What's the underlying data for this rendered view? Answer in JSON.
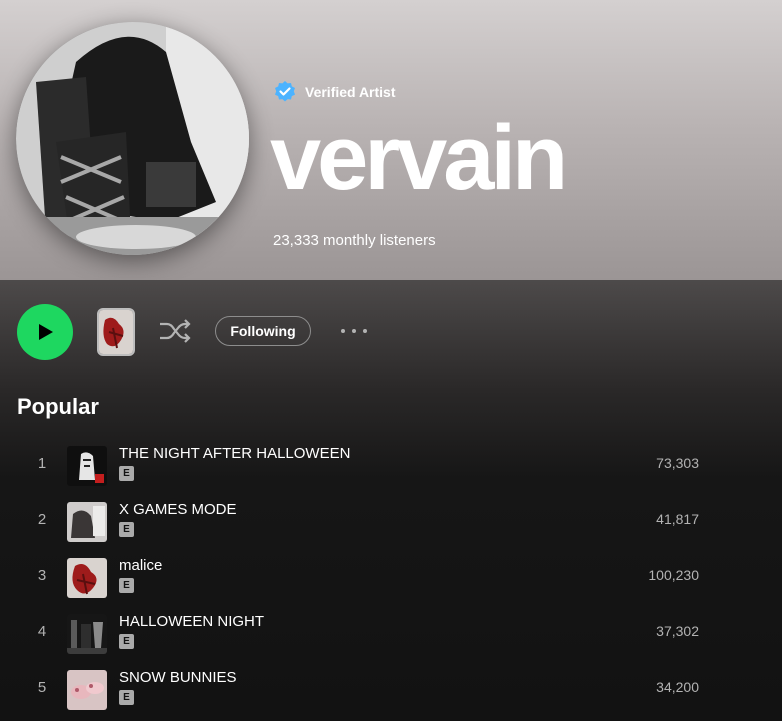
{
  "artist": {
    "verified_label": "Verified Artist",
    "name": "vervain",
    "monthly_listeners": "23,333 monthly listeners"
  },
  "controls": {
    "play_icon": "play-icon",
    "shuffle_icon": "shuffle-icon",
    "following_label": "Following",
    "more_icon": "more-options-icon"
  },
  "popular": {
    "title": "Popular",
    "explicit_badge": "E",
    "tracks": [
      {
        "index": "1",
        "title": "THE NIGHT AFTER HALLOWEEN",
        "plays": "73,303"
      },
      {
        "index": "2",
        "title": "X GAMES MODE",
        "plays": "41,817"
      },
      {
        "index": "3",
        "title": "malice",
        "plays": "100,230"
      },
      {
        "index": "4",
        "title": "HALLOWEEN NIGHT",
        "plays": "37,302"
      },
      {
        "index": "5",
        "title": "SNOW BUNNIES",
        "plays": "34,200"
      }
    ]
  },
  "colors": {
    "accent": "#1ed760",
    "verified_blue": "#4cb3ff",
    "background": "#121212",
    "text_secondary": "#b3b3b3"
  }
}
